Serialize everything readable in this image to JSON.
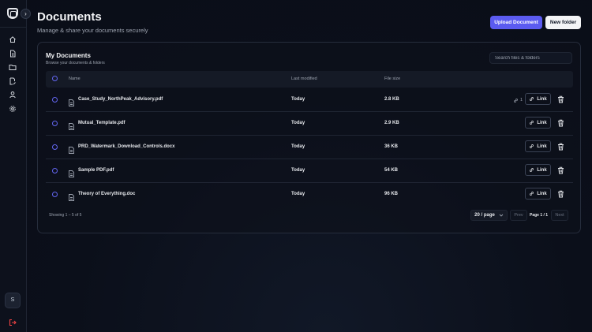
{
  "sidebar": {
    "avatar_initial": "S",
    "nav_items": [
      {
        "icon": "home-icon"
      },
      {
        "icon": "document-icon"
      },
      {
        "icon": "folder-icon"
      },
      {
        "icon": "document-edit-icon"
      },
      {
        "icon": "user-icon"
      },
      {
        "icon": "settings-icon"
      }
    ]
  },
  "header": {
    "title": "Documents",
    "subtitle": "Manage & share your documents securely",
    "upload_label": "Upload Document",
    "new_folder_label": "New folder"
  },
  "card": {
    "title": "My Documents",
    "subtitle": "Browse your documents & folders",
    "search_placeholder": "Search files & folders"
  },
  "table": {
    "columns": [
      "Name",
      "Last modified",
      "File size"
    ],
    "rows": [
      {
        "name": "Case_Study_NorthPeak_Advisory.pdf",
        "modified": "Today",
        "size": "2.8 KB",
        "link_count": "1",
        "link_label": "Link"
      },
      {
        "name": "Mutual_Template.pdf",
        "modified": "Today",
        "size": "2.9 KB",
        "link_label": "Link"
      },
      {
        "name": "PRD_Watermark_Download_Controls.docx",
        "modified": "Today",
        "size": "36 KB",
        "link_label": "Link"
      },
      {
        "name": "Sample PDF.pdf",
        "modified": "Today",
        "size": "54 KB",
        "link_label": "Link"
      },
      {
        "name": "Theory of Everything.doc",
        "modified": "Today",
        "size": "96 KB",
        "link_label": "Link"
      }
    ]
  },
  "footer": {
    "showing": "Showing 1 – 5 of 5",
    "per_page": "20 / page",
    "prev_label": "Prev",
    "page_indicator": "Page 1 / 1",
    "next_label": "Next"
  },
  "colors": {
    "accent": "#5b5bf0",
    "background": "#0b0f1a"
  }
}
